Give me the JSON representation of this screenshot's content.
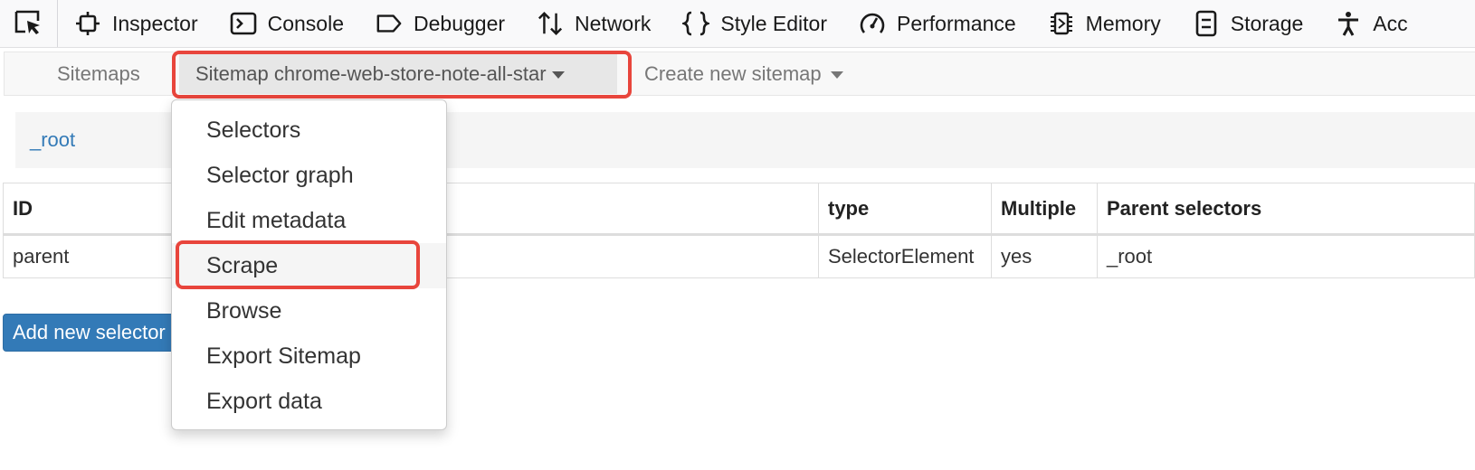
{
  "devtools": {
    "tabs": [
      {
        "label": "Inspector",
        "icon": "inspector-icon"
      },
      {
        "label": "Console",
        "icon": "console-icon"
      },
      {
        "label": "Debugger",
        "icon": "debugger-icon"
      },
      {
        "label": "Network",
        "icon": "network-icon"
      },
      {
        "label": "Style Editor",
        "icon": "style-editor-icon"
      },
      {
        "label": "Performance",
        "icon": "performance-icon"
      },
      {
        "label": "Memory",
        "icon": "memory-icon"
      },
      {
        "label": "Storage",
        "icon": "storage-icon"
      },
      {
        "label": "Acc",
        "icon": "accessibility-icon"
      }
    ]
  },
  "nav": {
    "sitemaps": "Sitemaps",
    "current_sitemap": "Sitemap chrome-web-store-note-all-star",
    "create_new": "Create new sitemap"
  },
  "breadcrumb": {
    "root": "_root"
  },
  "table": {
    "headers": [
      "ID",
      "type",
      "Multiple",
      "Parent selectors"
    ],
    "rows": [
      {
        "id": "parent",
        "type": "SelectorElement",
        "multiple": "yes",
        "parents": "_root"
      }
    ]
  },
  "add_button": "Add new selector",
  "dropdown": {
    "items": [
      "Selectors",
      "Selector graph",
      "Edit metadata",
      "Scrape",
      "Browse",
      "Export Sitemap",
      "Export data"
    ],
    "active_index": 3
  },
  "colors": {
    "highlight": "#e8453c",
    "link": "#337ab7",
    "primary_button": "#337ab7"
  }
}
